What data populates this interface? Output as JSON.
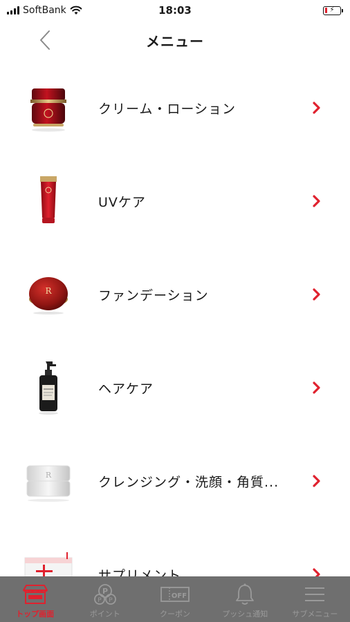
{
  "status_bar": {
    "carrier": "SoftBank",
    "time": "18:03",
    "battery_level": 0.18,
    "battery_state": "charging"
  },
  "nav": {
    "title": "メニュー",
    "back_icon": "chevron-left-icon"
  },
  "menu": {
    "items": [
      {
        "label": "クリーム・ローション",
        "thumbnail": "cream-jar",
        "chevron_icon": "chevron-right-icon"
      },
      {
        "label": "UVケア",
        "thumbnail": "uv-tube",
        "chevron_icon": "chevron-right-icon"
      },
      {
        "label": "ファンデーション",
        "thumbnail": "foundation-compact",
        "chevron_icon": "chevron-right-icon"
      },
      {
        "label": "ヘアケア",
        "thumbnail": "hair-bottle",
        "chevron_icon": "chevron-right-icon"
      },
      {
        "label": "クレンジング・洗顔・角質...",
        "thumbnail": "cleansing-jar",
        "chevron_icon": "chevron-right-icon"
      },
      {
        "label": "サプリメント",
        "thumbnail": "supplement-box",
        "chevron_icon": "chevron-right-icon"
      }
    ]
  },
  "tab_bar": {
    "tabs": [
      {
        "label": "トップ画面",
        "icon": "home-shop-icon",
        "active": true
      },
      {
        "label": "ポイント",
        "icon": "point-icon",
        "active": false
      },
      {
        "label": "クーポン",
        "icon": "coupon-off-icon",
        "active": false
      },
      {
        "label": "プッシュ通知",
        "icon": "bell-icon",
        "active": false
      },
      {
        "label": "サブメニュー",
        "icon": "hamburger-menu-icon",
        "active": false
      }
    ]
  },
  "colors": {
    "accent": "#e0212e",
    "tab_bar_bg": "#6f6f6f",
    "tab_inactive": "#9a9a9a",
    "text": "#1a1a1a"
  }
}
